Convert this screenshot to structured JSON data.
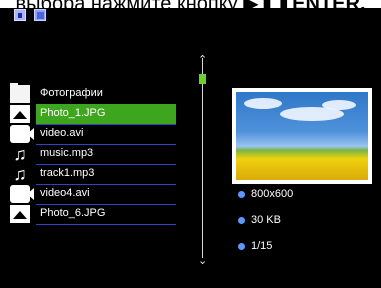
{
  "caption": {
    "text_prefix": "выбора нажмите кнопку ",
    "text_bold": "ENTER."
  },
  "files": [
    {
      "name": "Фотографии",
      "icon": "folder-icon",
      "selected": false
    },
    {
      "name": "Photo_1.JPG",
      "icon": "image-icon",
      "selected": true
    },
    {
      "name": "video.avi",
      "icon": "video-icon",
      "selected": false
    },
    {
      "name": "music.mp3",
      "icon": "music-icon",
      "selected": false
    },
    {
      "name": "track1.mp3",
      "icon": "music-icon",
      "selected": false
    },
    {
      "name": "video4.avi",
      "icon": "video-icon",
      "selected": false
    },
    {
      "name": "Photo_6.JPG",
      "icon": "image-icon",
      "selected": false
    }
  ],
  "info": {
    "resolution": "800x600",
    "size": "30 KB",
    "index": "1/15"
  },
  "colors": {
    "selection": "#3ea61e",
    "separator": "#3042c8",
    "scroll_thumb": "#6bcf2f",
    "bullet": "#5a9aff"
  }
}
